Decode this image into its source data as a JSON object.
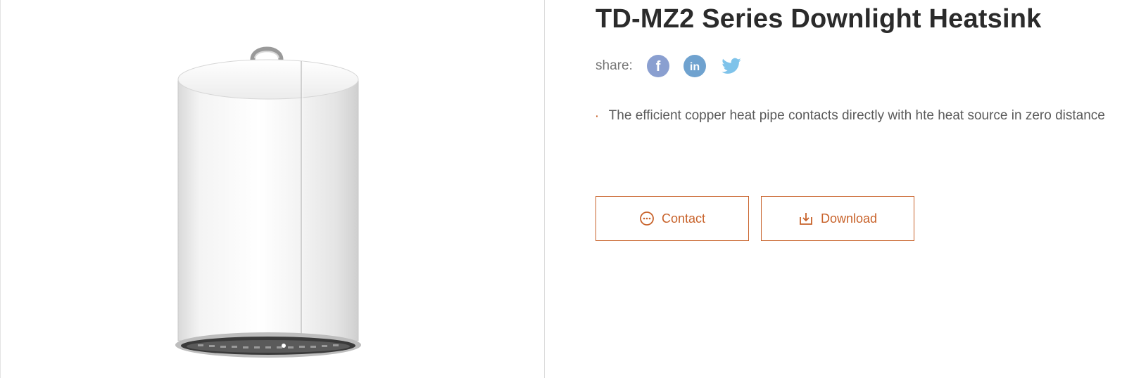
{
  "product": {
    "title": "TD-MZ2 Series Downlight Heatsink",
    "image_alt": "downlight-heatsink-product-image"
  },
  "share": {
    "label": "share:",
    "icons": [
      "facebook-icon",
      "linkedin-icon",
      "twitter-icon"
    ]
  },
  "features": [
    "The efficient copper heat pipe contacts directly with hte heat source in zero distance"
  ],
  "buttons": {
    "contact": "Contact",
    "download": "Download"
  },
  "colors": {
    "accent": "#c8622a",
    "title": "#2b2b2b",
    "text": "#5a5a5a",
    "facebook": "#8a9fd0",
    "linkedin": "#6fa2cf",
    "twitter": "#7fc3ea"
  }
}
